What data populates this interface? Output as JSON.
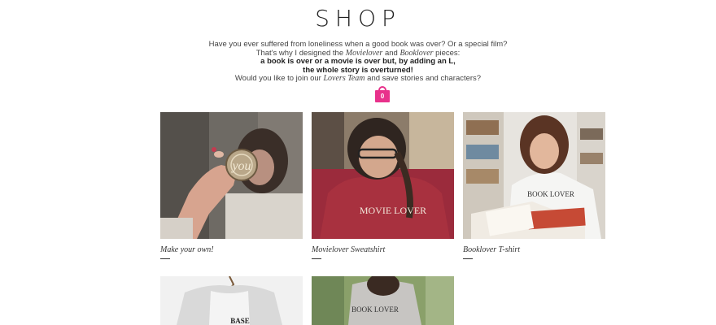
{
  "header": {
    "title": "SHOP"
  },
  "intro": {
    "line1": "Have you ever suffered from loneliness when a good book was over? Or a special film?",
    "line2_a": "That's why I designed the ",
    "line2_b": "Movielover",
    "line2_c": " and ",
    "line2_d": "Booklover",
    "line2_e": " pieces:",
    "line3": "a book is over or a movie is over but, by adding an L,",
    "line4": "the whole story is overturned!",
    "line5_a": "Would you like to join our ",
    "line5_b": "Lovers Team",
    "line5_c": " and save stories and characters?"
  },
  "cart": {
    "count": "0",
    "icon": "shopping-bag-icon",
    "color": "#e8318b"
  },
  "products": [
    {
      "name": "Make your own!",
      "image_text": "you"
    },
    {
      "name": "Movielover Sweatshirt",
      "image_text": "MOVIE LOVER"
    },
    {
      "name": "Booklover T-shirt",
      "image_text": "BOOK LOVER"
    },
    {
      "name": "",
      "image_text": "BASE"
    },
    {
      "name": "",
      "image_text": "BOOK LOVER"
    }
  ]
}
